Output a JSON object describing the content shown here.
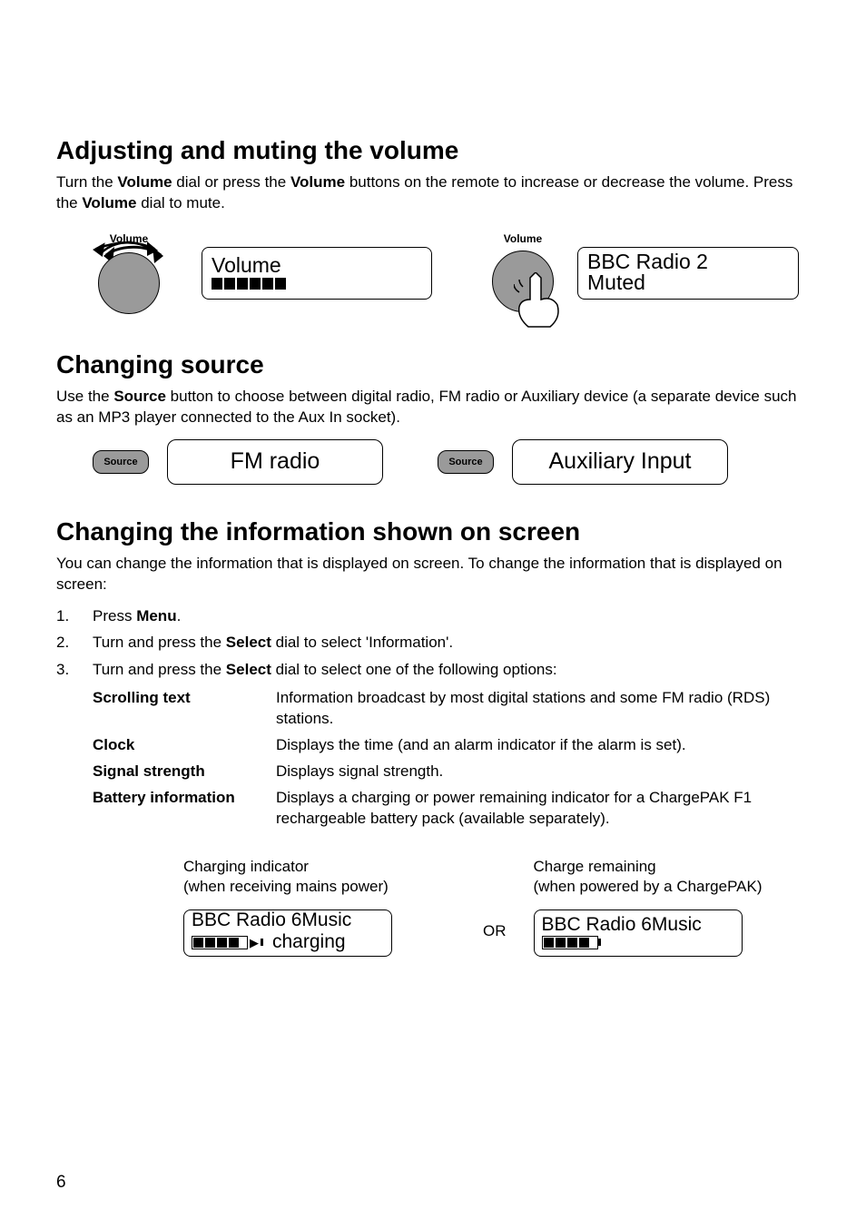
{
  "page_number": "6",
  "sec_volume": {
    "heading": "Adjusting and muting the volume",
    "p1_a": "Turn the ",
    "p1_b": "Volume",
    "p1_c": " dial or press the ",
    "p1_d": "Volume",
    "p1_e": " buttons on the remote to increase or decrease the volume. Press the ",
    "p1_f": "Volume",
    "p1_g": " dial to mute.",
    "dial1_label": "Volume",
    "lcd1_line1": "Volume",
    "dial2_label": "Volume",
    "lcd2_line1": "BBC Radio 2",
    "lcd2_line2": "Muted"
  },
  "sec_source": {
    "heading": "Changing source",
    "p1_a": "Use the ",
    "p1_b": "Source",
    "p1_c": " button to choose between digital radio, FM radio or Auxiliary device (a separate device such as an MP3 player connected to the Aux In socket).",
    "button_label": "Source",
    "lcd1": "FM radio",
    "lcd2": "Auxiliary Input"
  },
  "sec_info": {
    "heading": "Changing the information shown on screen",
    "p1": "You can change the information that is displayed on screen. To change the information that is displayed on screen:",
    "step1_a": "Press ",
    "step1_b": "Menu",
    "step1_c": ".",
    "step2_a": "Turn and press the ",
    "step2_b": "Select",
    "step2_c": " dial to select 'Information'.",
    "step3_a": "Turn and press the ",
    "step3_b": "Select",
    "step3_c": " dial to select one of the following options:",
    "defs": {
      "scrolling_term": "Scrolling text",
      "scrolling_desc": "Information broadcast by most digital stations and some FM radio (RDS) stations.",
      "clock_term": "Clock",
      "clock_desc": "Displays the time (and an alarm indicator if the alarm is set).",
      "signal_term": "Signal strength",
      "signal_desc": "Displays signal strength.",
      "battery_term": "Battery information",
      "battery_desc": "Displays a charging or power remaining indicator for a ChargePAK F1 rechargeable battery pack (available separately)."
    },
    "battery": {
      "cap1_l1": "Charging indicator",
      "cap1_l2": "(when receiving mains power)",
      "cap2_l1": "Charge remaining",
      "cap2_l2": "(when powered by a ChargePAK)",
      "or": "OR",
      "lcd_title": "BBC Radio 6Music",
      "charging_label": "charging"
    }
  }
}
